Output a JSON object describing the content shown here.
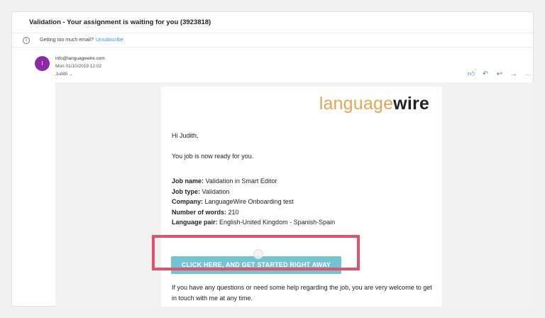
{
  "email": {
    "subject": "Validation - Your assignment is waiting for you (3923818)",
    "notice": {
      "text": "Getting too much email?",
      "unsubscribe_label": "Unsubscribe"
    },
    "sender": {
      "avatar_letter": "I",
      "address": "info@languagewire.com",
      "date": "Mon 01/10/2019 12:02",
      "to": "Judith"
    },
    "actions": [
      "like-icon",
      "reply-icon",
      "reply-all-icon",
      "forward-icon",
      "more-icon"
    ]
  },
  "message": {
    "logo_part1": "language",
    "logo_part2": "wire",
    "greeting": "Hi Judith,",
    "ready_text": "You job is now ready for you.",
    "details": [
      {
        "label": "Job name:",
        "value": " Validation in Smart Editor"
      },
      {
        "label": "Job type:",
        "value": " Validation"
      },
      {
        "label": "Company:",
        "value": " LanguageWire Onboarding test"
      },
      {
        "label": "Number of words:",
        "value": " 210"
      },
      {
        "label": "Language pair:",
        "value": " English-United Kingdom - Spanish-Spain"
      }
    ],
    "cta_label": "CLICK HERE, AND GET STARTED RIGHT AWAY",
    "outro": "If you have any questions or need some help regarding the job, you are very welcome to get in touch with me at any time."
  },
  "colors": {
    "avatar": "#8e2aa8",
    "cta": "#74c3d2",
    "highlight": "#e0536a",
    "logo_accent": "#e6a552",
    "link": "#3b8ed8"
  }
}
